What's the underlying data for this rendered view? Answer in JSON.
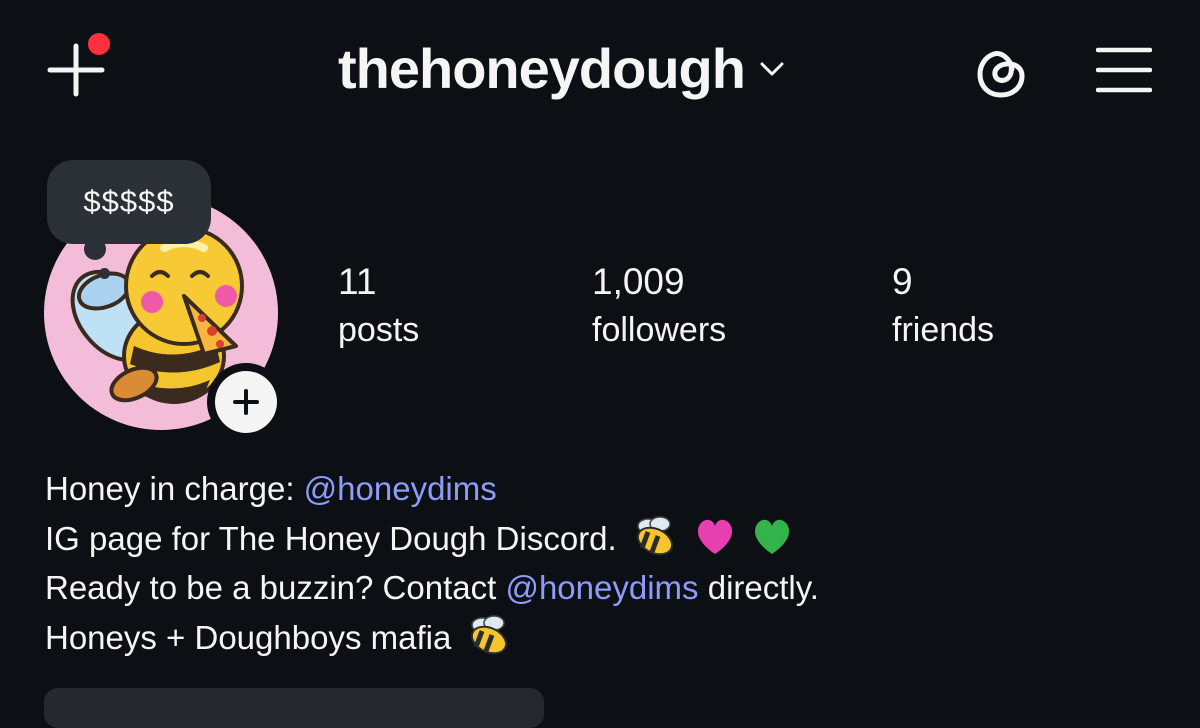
{
  "header": {
    "username": "thehoneydough",
    "has_notification": true,
    "icons": {
      "new_post": "plus-icon",
      "switch_account": "chevron-down-icon",
      "threads": "threads-icon",
      "menu": "hamburger-menu-icon"
    }
  },
  "profile": {
    "note": "$$$$$",
    "avatar": "bee-eating-pizza-avatar",
    "add_story_icon": "plus-icon"
  },
  "stats": [
    {
      "value": "11",
      "label": "posts"
    },
    {
      "value": "1,009",
      "label": "followers"
    },
    {
      "value": "9",
      "label": "friends"
    }
  ],
  "bio": {
    "line1": {
      "text": "Honey in charge: ",
      "mention": "@honeydims"
    },
    "line2": {
      "text": "IG page for The Honey Dough Discord.",
      "emojis": [
        "bee-emoji",
        "pink-heart-emoji",
        "green-heart-emoji"
      ]
    },
    "line3": {
      "text_before": "Ready to be a buzzin? Contact ",
      "mention": "@honeydims",
      "text_after": " directly."
    },
    "line4": {
      "text": "Honeys + Doughboys mafia",
      "emojis": [
        "bee-emoji"
      ]
    }
  },
  "colors": {
    "background": "#0c1014",
    "text": "#f5f5f5",
    "mention": "#8e9bf9",
    "notification_dot": "#ff3040",
    "note_bubble": "#2b3036",
    "avatar_bg": "#f3bdd9"
  }
}
